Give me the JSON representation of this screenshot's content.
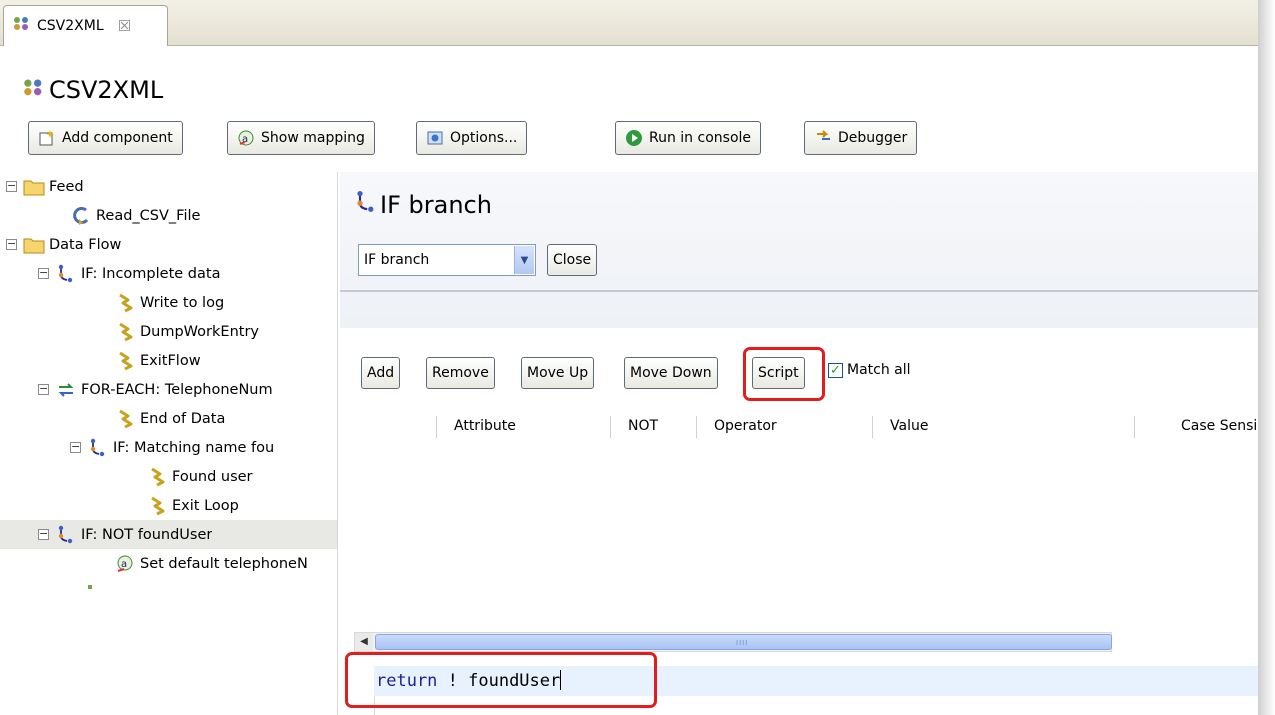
{
  "editor_tab": {
    "label": "CSV2XML",
    "close_glyph": "☒"
  },
  "editor": {
    "title": "CSV2XML"
  },
  "toolbar": {
    "add_component": "Add component",
    "show_mapping": "Show mapping",
    "options": "Options...",
    "run_in_console": "Run in console",
    "debugger": "Debugger"
  },
  "tree": {
    "items": [
      {
        "label": "Feed",
        "toggle": "⊟",
        "icon": "folder-icon"
      },
      {
        "label": "Read_CSV_File",
        "icon": "connector-icon"
      },
      {
        "label": "Data Flow",
        "toggle": "⊟",
        "icon": "folder-icon"
      },
      {
        "label": "IF: Incomplete data",
        "toggle": "⊟",
        "icon": "branch-icon"
      },
      {
        "label": "Write to log",
        "icon": "script-icon"
      },
      {
        "label": "DumpWorkEntry",
        "icon": "script-icon"
      },
      {
        "label": "ExitFlow",
        "icon": "script-icon"
      },
      {
        "label": "FOR-EACH: TelephoneNum",
        "toggle": "⊟",
        "icon": "loop-icon"
      },
      {
        "label": "End of Data",
        "icon": "script-icon"
      },
      {
        "label": "IF: Matching name fou",
        "toggle": "⊟",
        "icon": "branch-icon"
      },
      {
        "label": "Found user",
        "icon": "script-icon"
      },
      {
        "label": "Exit Loop",
        "icon": "script-icon"
      },
      {
        "label": "IF: NOT foundUser",
        "toggle": "⊟",
        "icon": "branch-icon",
        "selected": true
      },
      {
        "label": "Set default telephoneN",
        "icon": "attribute-map-icon"
      }
    ]
  },
  "panel": {
    "title": "IF branch",
    "branch_select": {
      "value": "IF branch"
    },
    "close_label": "Close",
    "buttons": {
      "add": "Add",
      "remove": "Remove",
      "move_up": "Move Up",
      "move_down": "Move Down",
      "script": "Script"
    },
    "match_all": {
      "label": "Match all",
      "checked": true
    },
    "columns": [
      "Attribute",
      "NOT",
      "Operator",
      "Value",
      "Case Sensi"
    ],
    "scroll_grip": "IIII",
    "script": {
      "keyword": "return",
      "expression": " ! foundUser"
    }
  },
  "colors": {
    "highlight": "#e31c1c",
    "script_line": "#e8f2fe",
    "keyword": "#1f1f8f"
  }
}
